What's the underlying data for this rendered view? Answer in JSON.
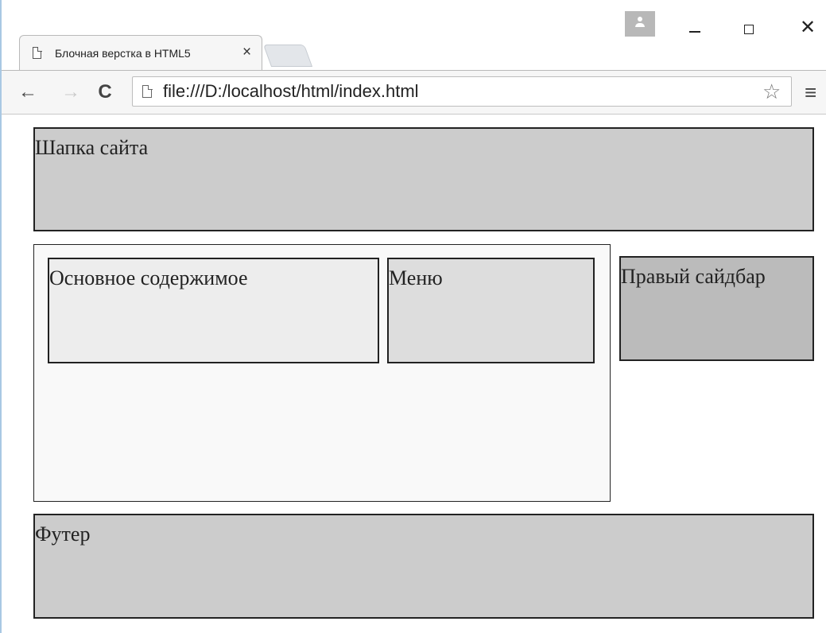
{
  "browser": {
    "tab_title": "Блочная верстка в HTML5",
    "tab_close": "×",
    "url": "file:///D:/localhost/html/index.html",
    "back_icon": "←",
    "forward_icon": "→",
    "reload_icon": "C",
    "star_icon": "☆",
    "menu_icon": "≡",
    "close_window": "✕"
  },
  "page": {
    "header": "Шапка сайта",
    "main_content": "Основное содержимое",
    "menu": "Меню",
    "right_sidebar": "Правый сайдбар",
    "footer": "Футер"
  },
  "colors": {
    "header_bg": "#cccccc",
    "content_bg": "#ededed",
    "menu_bg": "#dddddd",
    "sidebar_bg": "#bbbbbb",
    "footer_bg": "#cccccc"
  }
}
